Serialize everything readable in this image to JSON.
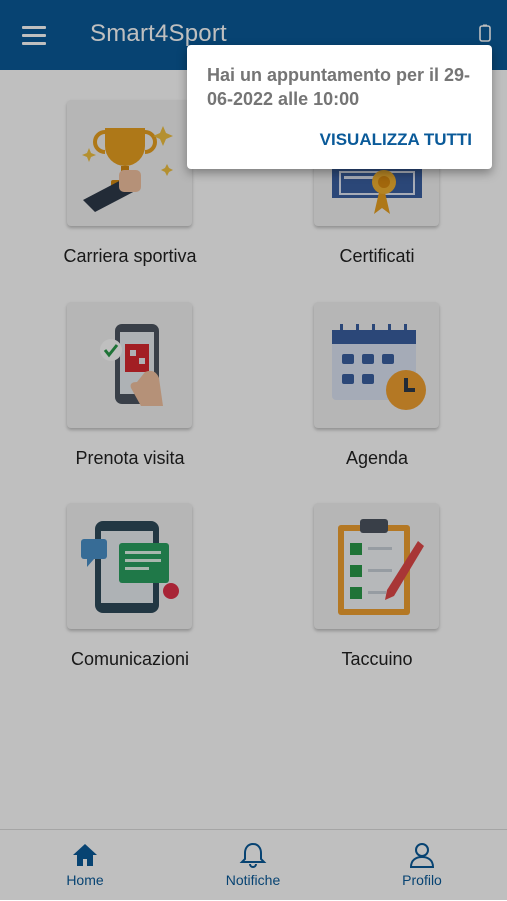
{
  "app": {
    "title": "Smart4Sport",
    "menu_icon": "hamburger-menu-icon",
    "device_icon": "device-icon"
  },
  "tiles": [
    {
      "label": "Carriera sportiva",
      "icon": "trophy-icon"
    },
    {
      "label": "Certificati",
      "icon": "certificate-icon"
    },
    {
      "label": "Prenota visita",
      "icon": "booking-phone-icon"
    },
    {
      "label": "Agenda",
      "icon": "calendar-clock-icon"
    },
    {
      "label": "Comunicazioni",
      "icon": "messages-phone-icon"
    },
    {
      "label": "Taccuino",
      "icon": "clipboard-checklist-icon"
    }
  ],
  "bottom_nav": [
    {
      "label": "Home",
      "icon": "home-icon"
    },
    {
      "label": "Notifiche",
      "icon": "bell-icon"
    },
    {
      "label": "Profilo",
      "icon": "user-icon"
    }
  ],
  "popup": {
    "message": "Hai un appuntamento per il 29-06-2022 alle 10:00",
    "action": "VISUALIZZA TUTTI"
  },
  "colors": {
    "primary": "#0a5a99",
    "popup_text": "#757575",
    "tile_bg": "#f3f3f3"
  }
}
